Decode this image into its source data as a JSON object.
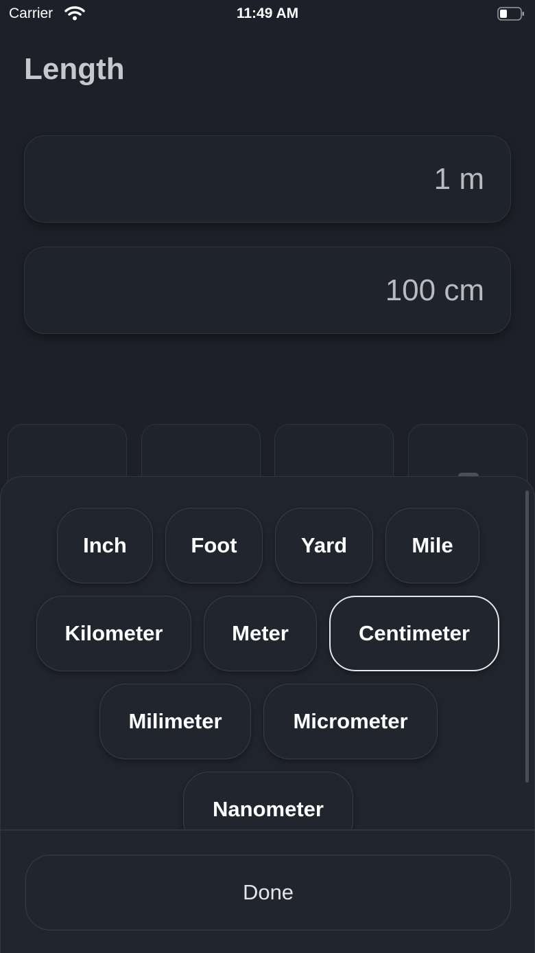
{
  "status_bar": {
    "carrier": "Carrier",
    "time": "11:49 AM",
    "icons": [
      "wifi-icon",
      "battery-icon"
    ]
  },
  "page": {
    "title": "Length"
  },
  "fields": {
    "from_value": "1 m",
    "to_value": "100 cm"
  },
  "unit_sheet": {
    "units": [
      {
        "label": "Inch",
        "selected": false
      },
      {
        "label": "Foot",
        "selected": false
      },
      {
        "label": "Yard",
        "selected": false
      },
      {
        "label": "Mile",
        "selected": false
      },
      {
        "label": "Kilometer",
        "selected": false
      },
      {
        "label": "Meter",
        "selected": false
      },
      {
        "label": "Centimeter",
        "selected": true
      },
      {
        "label": "Milimeter",
        "selected": false
      },
      {
        "label": "Micrometer",
        "selected": false
      },
      {
        "label": "Nanometer",
        "selected": false
      }
    ],
    "done_label": "Done"
  },
  "colors": {
    "background": "#1d2028",
    "sheet": "#21252d",
    "selected_border": "#e6e7ea"
  }
}
